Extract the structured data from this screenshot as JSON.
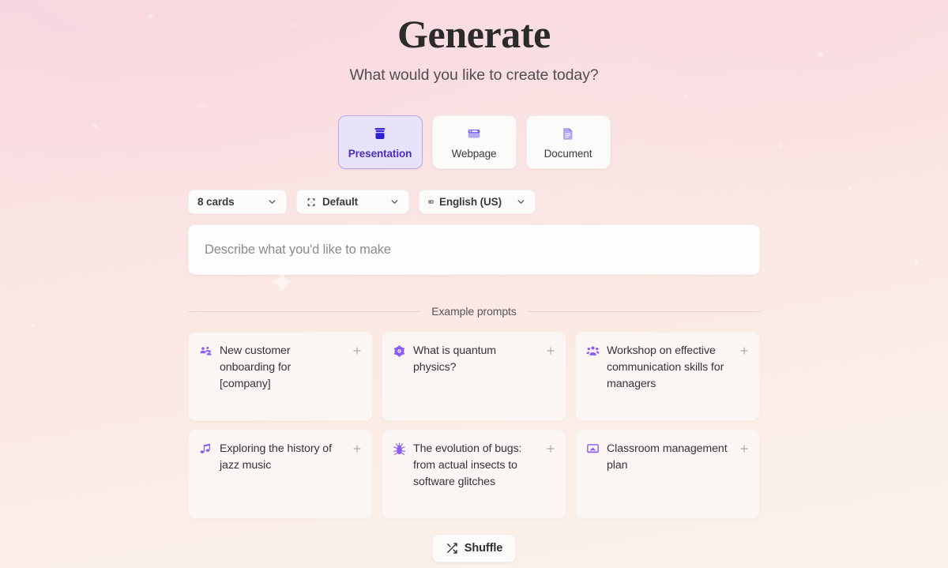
{
  "header": {
    "title": "Generate",
    "subtitle": "What would you like to create today?"
  },
  "format_selector": {
    "options": [
      {
        "label": "Presentation",
        "icon": "presentation-icon",
        "selected": true
      },
      {
        "label": "Webpage",
        "icon": "browser-window-icon",
        "selected": false
      },
      {
        "label": "Document",
        "icon": "document-icon",
        "selected": false
      }
    ]
  },
  "options_bar": {
    "cards": {
      "value": "8 cards",
      "icon": "chevron-down-icon"
    },
    "theme": {
      "value": "Default",
      "icon": "theme-brackets-icon"
    },
    "language": {
      "value": "English (US)",
      "icon": "translate-icon"
    }
  },
  "prompt": {
    "placeholder": "Describe what you'd like to make",
    "value": ""
  },
  "examples": {
    "divider_label": "Example prompts",
    "cards": [
      {
        "text": "New customer onboarding for [company]",
        "icon": "users-group-icon",
        "add": "+"
      },
      {
        "text": "What is quantum physics?",
        "icon": "atom-icon",
        "add": "+"
      },
      {
        "text": "Workshop on effective communication skills for managers",
        "icon": "users-group-icon",
        "add": "+"
      },
      {
        "text": "Exploring the history of jazz music",
        "icon": "music-note-icon",
        "add": "+"
      },
      {
        "text": "The evolution of bugs: from actual insects to software glitches",
        "icon": "bug-icon",
        "add": "+"
      },
      {
        "text": "Classroom management plan",
        "icon": "presentation-screen-icon",
        "add": "+"
      }
    ]
  },
  "footer": {
    "shuffle_label": "Shuffle",
    "shuffle_icon": "shuffle-icon"
  },
  "colors": {
    "accent_purple": "#8b5cf6",
    "accent_deep_blue": "#2f1fd0",
    "selected_bg": "#e8e2fb",
    "selected_border": "#bda9ef",
    "selected_text": "#4b2fbe",
    "bg_pink": "#f8dbe2",
    "bg_cream": "#fbf0ea",
    "card_bg": "#fbf6f3",
    "text_primary": "#2f2b30",
    "text_muted": "#8c8a8f"
  }
}
